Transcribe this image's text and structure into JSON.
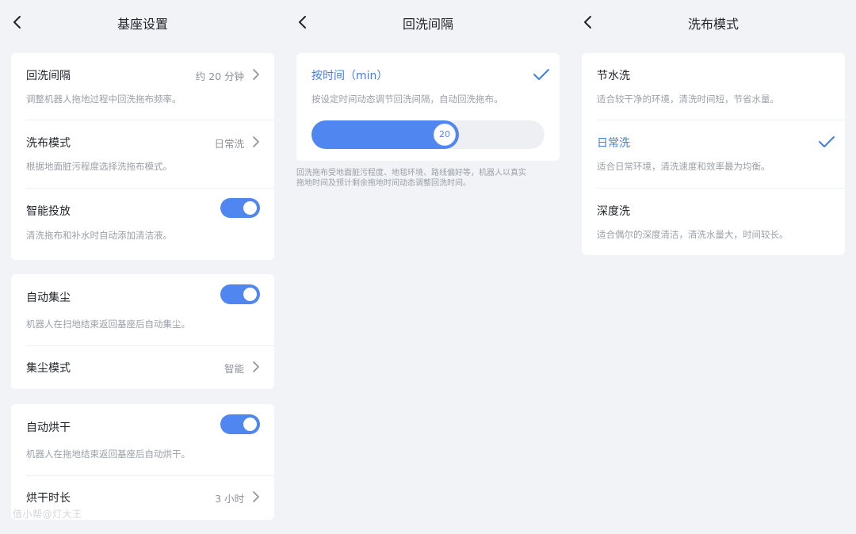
{
  "panels": {
    "dock": {
      "title": "基座设置",
      "items": {
        "wash_interval": {
          "title": "回洗间隔",
          "value": "约 20 分钟",
          "desc": "调整机器人拖地过程中回洗拖布频率。"
        },
        "wash_mode": {
          "title": "洗布模式",
          "value": "日常洗",
          "desc": "根据地面脏污程度选择洗拖布模式。"
        },
        "smart_dispense": {
          "title": "智能投放",
          "desc": "清洗拖布和补水时自动添加清洁液。",
          "enabled": true
        },
        "auto_dust": {
          "title": "自动集尘",
          "desc": "机器人在扫地结束返回基座后自动集尘。",
          "enabled": true
        },
        "dust_mode": {
          "title": "集尘模式",
          "value": "智能"
        },
        "auto_dry": {
          "title": "自动烘干",
          "desc": "机器人在拖地结束返回基座后自动烘干。",
          "enabled": true
        },
        "dry_duration": {
          "title": "烘干时长",
          "value": "3 小时"
        }
      }
    },
    "interval": {
      "title": "回洗间隔",
      "option": {
        "title": "按时间（min）",
        "desc": "按设定时间动态调节回洗间隔，自动回洗拖布。",
        "selected": true
      },
      "slider": {
        "value": "20",
        "min": 0,
        "max": 60
      },
      "note_line1": "回洗拖布受地面脏污程度、地毯环境、路线偏好等，机器人以真实",
      "note_line2": "拖地时间及预计剩余拖地时间动态调整回洗时间。"
    },
    "mode": {
      "title": "洗布模式",
      "options": [
        {
          "title": "节水洗",
          "desc": "适合较干净的环境，清洗时间短，节省水量。",
          "selected": false
        },
        {
          "title": "日常洗",
          "desc": "适合日常环境，清洗速度和效率最为均衡。",
          "selected": true
        },
        {
          "title": "深度洗",
          "desc": "适合偶尔的深度清洁，清洗水量大，时间较长。",
          "selected": false
        }
      ]
    }
  },
  "watermark": "值小帮@灯大王",
  "colors": {
    "accent": "#3f7df0",
    "toggle": "#4f86ef",
    "background": "#f2f3f6",
    "card": "#ffffff"
  }
}
